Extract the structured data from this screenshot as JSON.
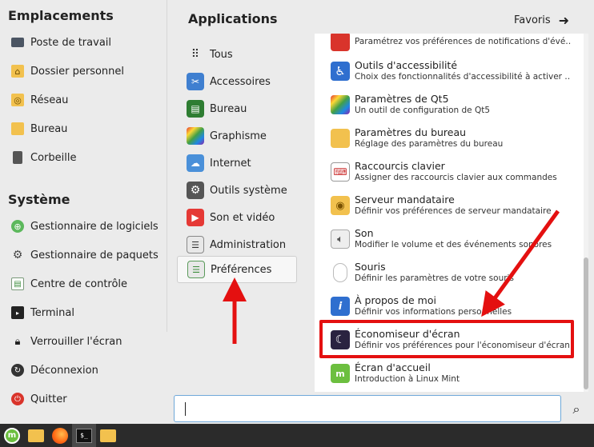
{
  "sidebar": {
    "places_title": "Emplacements",
    "places": [
      {
        "label": "Poste de travail",
        "icon": "monitor-icon"
      },
      {
        "label": "Dossier personnel",
        "icon": "home-folder-icon"
      },
      {
        "label": "Réseau",
        "icon": "network-folder-icon"
      },
      {
        "label": "Bureau",
        "icon": "desktop-folder-icon"
      },
      {
        "label": "Corbeille",
        "icon": "trash-icon"
      }
    ],
    "system_title": "Système",
    "system": [
      {
        "label": "Gestionnaire de logiciels",
        "icon": "software-manager-icon"
      },
      {
        "label": "Gestionnaire de paquets",
        "icon": "package-manager-icon"
      },
      {
        "label": "Centre de contrôle",
        "icon": "control-center-icon"
      },
      {
        "label": "Terminal",
        "icon": "terminal-icon"
      },
      {
        "label": "Verrouiller l'écran",
        "icon": "lock-icon"
      },
      {
        "label": "Déconnexion",
        "icon": "logout-icon"
      },
      {
        "label": "Quitter",
        "icon": "power-icon"
      }
    ]
  },
  "header": {
    "title": "Applications",
    "favorites": "Favoris",
    "favorites_icon": "arrow-right-icon"
  },
  "categories": [
    {
      "label": "Tous",
      "icon": "grid-icon"
    },
    {
      "label": "Accessoires",
      "icon": "scissors-icon"
    },
    {
      "label": "Bureau",
      "icon": "office-icon"
    },
    {
      "label": "Graphisme",
      "icon": "graphics-icon"
    },
    {
      "label": "Internet",
      "icon": "cloud-icon"
    },
    {
      "label": "Outils système",
      "icon": "gear-icon"
    },
    {
      "label": "Son et vidéo",
      "icon": "play-icon"
    },
    {
      "label": "Administration",
      "icon": "toggles-icon"
    },
    {
      "label": "Préférences",
      "icon": "toggles-icon",
      "selected": true
    }
  ],
  "apps": [
    {
      "name": "",
      "desc": "Paramétrez vos préférences de notifications d'évé…",
      "icon": "notifications-icon"
    },
    {
      "name": "Outils d'accessibilité",
      "desc": "Choix des fonctionnalités d'accessibilité à activer …",
      "icon": "accessibility-icon"
    },
    {
      "name": "Paramètres de Qt5",
      "desc": "Un outil de configuration de Qt5",
      "icon": "qt5-icon"
    },
    {
      "name": "Paramètres du bureau",
      "desc": "Réglage des paramètres du bureau",
      "icon": "desktop-settings-icon"
    },
    {
      "name": "Raccourcis clavier",
      "desc": "Assigner des raccourcis clavier aux commandes",
      "icon": "keyboard-icon"
    },
    {
      "name": "Serveur mandataire",
      "desc": "Définir vos préférences de serveur mandataire",
      "icon": "proxy-icon"
    },
    {
      "name": "Son",
      "desc": "Modifier le volume et des événements sonores",
      "icon": "speaker-icon"
    },
    {
      "name": "Souris",
      "desc": "Définir les paramètres de votre souris",
      "icon": "mouse-icon"
    },
    {
      "name": "À propos de moi",
      "desc": "Définir vos informations personnelles",
      "icon": "info-icon"
    },
    {
      "name": "Économiseur d'écran",
      "desc": "Définir vos préférences pour l'économiseur d'écran",
      "icon": "screensaver-icon",
      "highlighted": true
    },
    {
      "name": "Écran d'accueil",
      "desc": "Introduction à Linux Mint",
      "icon": "welcome-icon"
    }
  ],
  "search": {
    "value": "",
    "placeholder": "",
    "icon": "search-icon"
  },
  "taskbar": {
    "items": [
      "mint-menu-icon",
      "files-icon",
      "firefox-icon",
      "terminal-icon",
      "folder-icon"
    ],
    "terminal_glyph": "$_"
  },
  "colors": {
    "highlight": "#e41010",
    "arrow": "#e41010"
  }
}
